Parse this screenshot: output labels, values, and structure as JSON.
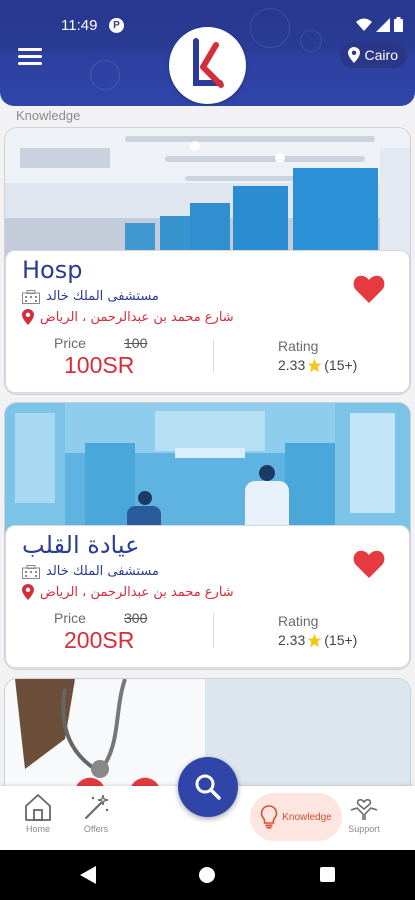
{
  "status_bar": {
    "time": "11:49",
    "app_badge": "P"
  },
  "header": {
    "location": "Cairo"
  },
  "section": {
    "title": "Knowledge"
  },
  "cards": [
    {
      "title": "Hosp",
      "hospital": "مستشفى الملك خالد",
      "address": "شارع محمد بن عبدالرحمن ، الرياض",
      "price_label": "Price",
      "old_price": "100",
      "price": "100SR",
      "rating_label": "Rating",
      "rating": "2.33",
      "reviews": "(15+)",
      "favorited": true
    },
    {
      "title": "عيادة القلب",
      "hospital": "مستشفى الملك خالد",
      "address": "شارع محمد بن عبدالرحمن ، الرياض",
      "price_label": "Price",
      "old_price": "300",
      "price": "200SR",
      "rating_label": "Rating",
      "rating": "2.33",
      "reviews": "(15+)",
      "favorited": true
    }
  ],
  "bottom_nav": {
    "items": [
      {
        "label": "Home",
        "icon": "home-icon"
      },
      {
        "label": "Offers",
        "icon": "magic-wand-icon"
      },
      {
        "label": "Knowledge",
        "icon": "lightbulb-icon",
        "active": true
      },
      {
        "label": "Support",
        "icon": "support-hands-icon"
      }
    ]
  },
  "colors": {
    "primary": "#2f45a8",
    "accent_red": "#d62d3b",
    "active_tab_bg": "#fde6df"
  }
}
